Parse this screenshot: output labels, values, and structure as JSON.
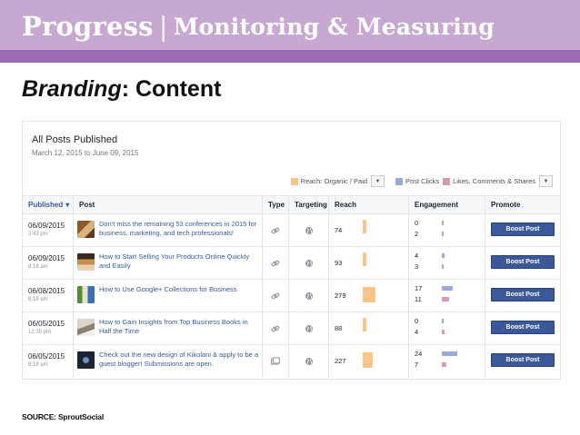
{
  "slide": {
    "title_main": "Progress",
    "title_separator": "|",
    "title_sub": "Monitoring & Measuring",
    "subtitle_emphasis": "Branding",
    "subtitle_rest": ": Content",
    "source": "SOURCE: SproutSocial"
  },
  "panel": {
    "title": "All Posts Published",
    "date_range": "March 12, 2015 to June 09, 2015",
    "legend": [
      {
        "label": "Reach: Organic / Paid",
        "color": "#f8c686",
        "dropdown": true
      },
      {
        "label": "Post Clicks",
        "color": "#9aa9d6",
        "dropdown": false
      },
      {
        "label": "Likes, Comments & Shares",
        "color": "#d99aae",
        "dropdown": true
      }
    ],
    "dropdown_icon": "chevron-down-icon"
  },
  "table": {
    "headers": {
      "published": "Published",
      "sort_indicator": "▾",
      "post": "Post",
      "type": "Type",
      "targeting": "Targeting",
      "reach": "Reach",
      "engagement": "Engagement",
      "promote": "Promote"
    },
    "rows": [
      {
        "date": "06/09/2015",
        "time": "2:43 pm",
        "post": "Don't miss the remaining 53 conferences in 2015 for business, marketing, and tech professionals!",
        "type_icon": "link-icon",
        "targeting_icon": "globe-icon",
        "reach": "74",
        "reach_level": 0.27,
        "clicks": "0",
        "likes": "2",
        "clicks_level": 0.05,
        "likes_level": 0.12,
        "promote": "Boost Post"
      },
      {
        "date": "06/09/2015",
        "time": "8:18 am",
        "post": "How to Start Selling Your Products Online Quickly and Easily",
        "type_icon": "link-icon",
        "targeting_icon": "globe-icon",
        "reach": "93",
        "reach_level": 0.33,
        "clicks": "4",
        "likes": "3",
        "clicks_level": 0.24,
        "likes_level": 0.18,
        "promote": "Boost Post"
      },
      {
        "date": "06/08/2015",
        "time": "8:18 am",
        "post": "How to Use Google+ Collections for Business",
        "type_icon": "link-icon",
        "targeting_icon": "globe-icon",
        "reach": "279",
        "reach_level": 1.0,
        "clicks": "17",
        "likes": "11",
        "clicks_level": 1.0,
        "likes_level": 0.65,
        "promote": "Boost Post"
      },
      {
        "date": "06/05/2015",
        "time": "12:35 pm",
        "post": "How to Gain Insights from Top Business Books in Half the Time",
        "type_icon": "link-icon",
        "targeting_icon": "globe-icon",
        "reach": "88",
        "reach_level": 0.32,
        "clicks": "0",
        "likes": "4",
        "clicks_level": 0.05,
        "likes_level": 0.24,
        "promote": "Boost Post"
      },
      {
        "date": "06/05/2015",
        "time": "8:18 am",
        "post": "Check out the new design of Kikolani & apply to be a guest blogger! Submissions are open.",
        "type_icon": "photo-icon",
        "targeting_icon": "globe-icon",
        "reach": "227",
        "reach_level": 0.81,
        "clicks": "24",
        "likes": "7",
        "clicks_level": 1.41,
        "likes_level": 0.41,
        "promote": "Boost Post"
      }
    ]
  },
  "colors": {
    "header_band": "#c6a8d3",
    "header_strip": "#9b6db7",
    "facebook_blue": "#3b5998",
    "reach": "#f8c686",
    "clicks": "#9aa9d6",
    "likes": "#d99aae"
  }
}
